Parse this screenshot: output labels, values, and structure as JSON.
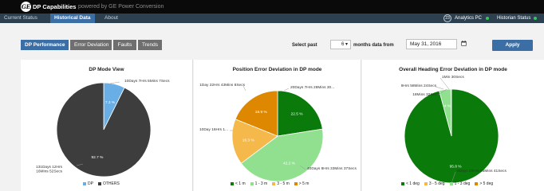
{
  "header": {
    "logo_text": "GE",
    "title": "DP Capabilities",
    "subtitle": "powered by GE Power Conversion"
  },
  "nav": {
    "tabs": [
      {
        "label": "Current Status",
        "active": false
      },
      {
        "label": "Historical Data",
        "active": true
      },
      {
        "label": "About",
        "active": false
      }
    ],
    "count_badge": "23",
    "status_items": [
      {
        "label": "Analytics PC",
        "color": "#34c759"
      },
      {
        "label": "Historian Status",
        "color": "#34c759"
      }
    ]
  },
  "toolbar": {
    "subtabs": [
      {
        "label": "DP Performance",
        "active": true
      },
      {
        "label": "Error Deviation",
        "active": false
      },
      {
        "label": "Faults",
        "active": false
      },
      {
        "label": "Trends",
        "active": false
      }
    ],
    "select_past_label": "Select past",
    "months_value": "6",
    "months_label": "months data from",
    "date_value": "May 31, 2016",
    "apply_label": "Apply"
  },
  "colors": {
    "blue": "#6aaee6",
    "dark": "#3d3d3d",
    "green_dark": "#0a7a0a",
    "green_light": "#90e090",
    "orange_light": "#f5b84a",
    "orange_dark": "#dd8800",
    "nav_bg": "#2d4050",
    "accent": "#3b6ea5"
  },
  "chart_data": [
    {
      "type": "pie",
      "title": "DP Mode View",
      "slices": [
        {
          "name": "DP",
          "value": 7.3,
          "label": "7.3 %",
          "annotation": "10Days 7Hrs 5Mins 7Secs",
          "color": "#6aaee6"
        },
        {
          "name": "OTHERS",
          "value": 92.7,
          "label": "92.7 %",
          "annotation": "131Days 12Hrs 16Mins 52Secs",
          "color": "#3d3d3d"
        }
      ],
      "legend": [
        "DP",
        "OTHERS"
      ]
    },
    {
      "type": "pie",
      "title": "Position Error Deviation in DP mode",
      "slices": [
        {
          "name": "< 1 m",
          "value": 22.5,
          "label": "22.5 %",
          "annotation": "20Days 7Hrs 28Mins 30...",
          "color": "#0a7a0a"
        },
        {
          "name": "1 - 3 m",
          "value": 42.2,
          "label": "42.2 %",
          "annotation": "40Days 8Hrs 33Mins 37Secs",
          "color": "#90e090"
        },
        {
          "name": "3 - 5 m",
          "value": 16.3,
          "label": "16.3 %",
          "annotation": "10Day 16Hrs 1...",
          "color": "#f5b84a"
        },
        {
          "name": "> 5 m",
          "value": 18.9,
          "label": "18.9 %",
          "annotation": "1Day 22Hrs 43Mins 8Secs",
          "color": "#dd8800"
        }
      ],
      "legend": [
        "< 1 m",
        "1 - 3 m",
        "3 - 5 m",
        "> 5 m"
      ]
    },
    {
      "type": "pie",
      "title": "Overall Heading Error Deviation in DP mode",
      "slices": [
        {
          "name": "< 1 deg",
          "value": 95.8,
          "label": "95.8 %",
          "annotation": "9Days 20Hrs 46Mins 41Secs",
          "color": "#0a7a0a"
        },
        {
          "name": "1 - 3 deg",
          "value": 4.0,
          "label": "4 %",
          "annotation": "9Hrs 58Mins 24Secs",
          "color": "#90e090"
        },
        {
          "name": "3 - 5 deg",
          "value": 0.1,
          "label": "",
          "annotation": "18Mins 32Secs",
          "color": "#f5b84a"
        },
        {
          "name": "> 5 deg",
          "value": 0.1,
          "label": "",
          "annotation": "1Min 30Secs",
          "color": "#dd8800"
        }
      ],
      "legend": [
        "< 1 deg",
        "3 - 5 deg",
        "1 - 3 deg",
        "> 5 deg"
      ],
      "legend_colors": [
        "#0a7a0a",
        "#f5b84a",
        "#90e090",
        "#dd8800"
      ]
    }
  ]
}
